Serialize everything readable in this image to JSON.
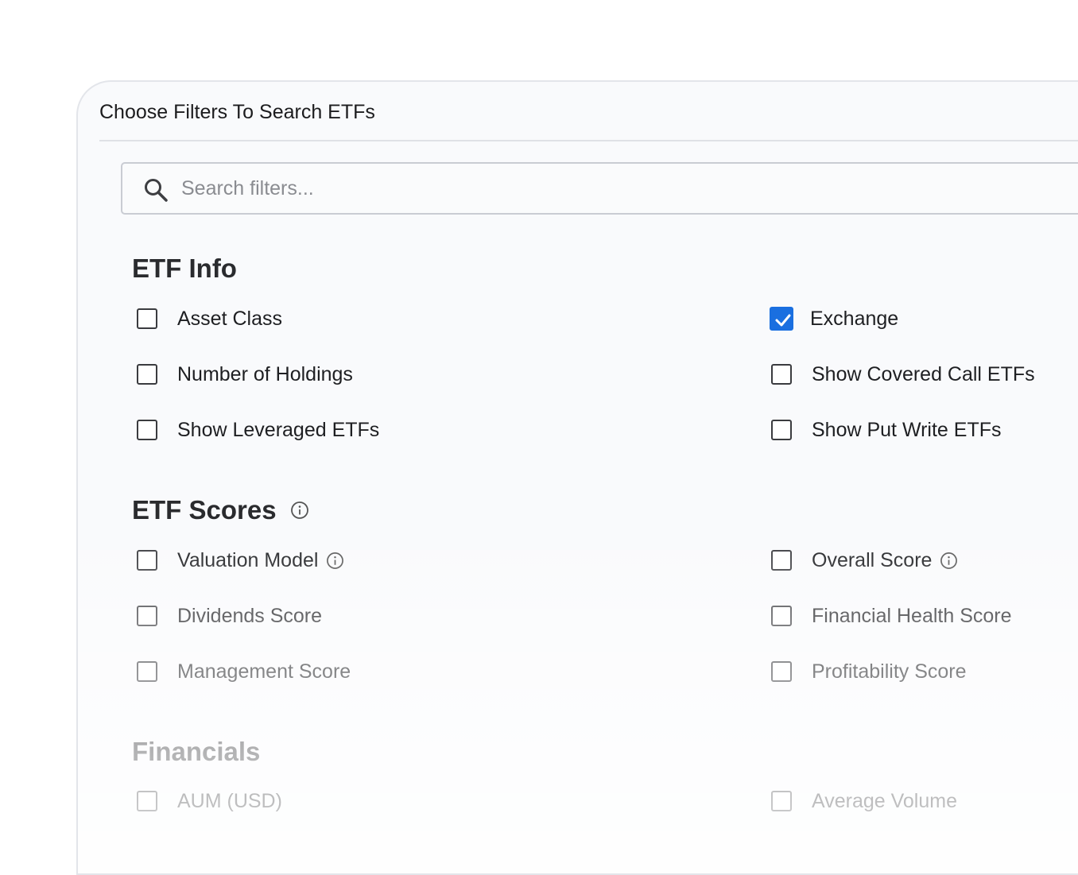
{
  "panel": {
    "title": "Choose Filters To Search ETFs"
  },
  "search": {
    "placeholder": "Search filters..."
  },
  "sections": {
    "etf_info": {
      "title": "ETF Info",
      "left": [
        {
          "label": "Asset Class",
          "checked": false
        },
        {
          "label": "Number of Holdings",
          "checked": false
        },
        {
          "label": "Show Leveraged ETFs",
          "checked": false
        }
      ],
      "right": [
        {
          "label": "Exchange",
          "checked": true
        },
        {
          "label": "Show Covered Call ETFs",
          "checked": false
        },
        {
          "label": "Show Put Write ETFs",
          "checked": false
        }
      ]
    },
    "etf_scores": {
      "title": "ETF Scores",
      "left": [
        {
          "label": "Valuation Model",
          "checked": false
        },
        {
          "label": "Dividends Score",
          "checked": false
        },
        {
          "label": "Management Score",
          "checked": false
        }
      ],
      "right": [
        {
          "label": "Overall Score",
          "checked": false
        },
        {
          "label": "Financial Health Score",
          "checked": false
        },
        {
          "label": "Profitability Score",
          "checked": false
        }
      ]
    },
    "financials": {
      "title": "Financials",
      "left": [
        {
          "label": "AUM (USD)",
          "checked": false
        }
      ],
      "right": [
        {
          "label": "Average Volume",
          "checked": false
        }
      ]
    }
  },
  "colors": {
    "accent": "#1a6fe0",
    "panel_bg": "#f9fafc",
    "border": "#e3e5ea"
  }
}
